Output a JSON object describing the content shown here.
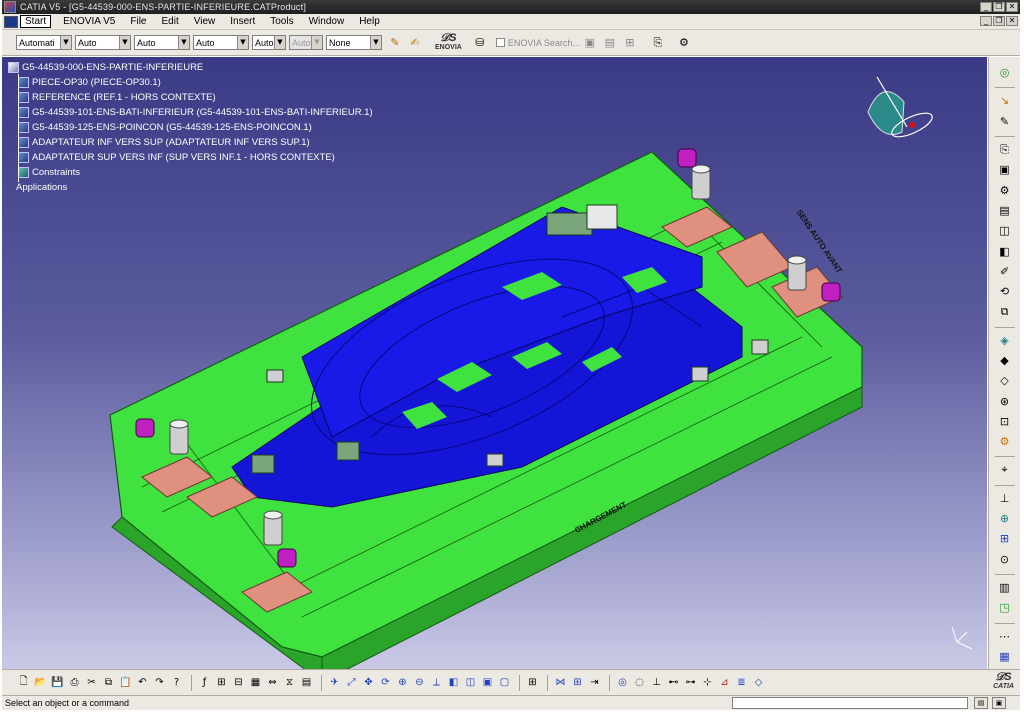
{
  "window": {
    "title": "CATIA V5 - [G5-44539-000-ENS-PARTIE-INFERIEURE.CATProduct]",
    "controls": {
      "minimize": "_",
      "restore": "❐",
      "close": "✕"
    }
  },
  "menu": {
    "items": [
      "Start",
      "ENOVIA V5",
      "File",
      "Edit",
      "View",
      "Insert",
      "Tools",
      "Window",
      "Help"
    ]
  },
  "toolbar_top": {
    "combos": [
      {
        "value": "Automati",
        "disabled": false
      },
      {
        "value": "Auto",
        "disabled": false
      },
      {
        "value": "Auto",
        "disabled": false
      },
      {
        "value": "Auto",
        "disabled": false
      },
      {
        "value": "Auto",
        "disabled": false
      },
      {
        "value": "Auto",
        "disabled": true
      },
      {
        "value": "None",
        "disabled": false
      }
    ],
    "enovia_logo": "ENOVIA",
    "enovia_search": "ENOVIA Search..."
  },
  "tree": {
    "root": "G5-44539-000-ENS-PARTIE-INFERIEURE",
    "children": [
      "PIECE-OP30 (PIECE-OP30.1)",
      "REFERENCE (REF.1 - HORS CONTEXTE)",
      "G5-44539-101-ENS-BATI-INFERIEUR (G5-44539-101-ENS-BATI-INFERIEUR.1)",
      "G5-44539-125-ENS-POINCON (G5-44539-125-ENS-POINCON.1)",
      "ADAPTATEUR INF VERS SUP (ADAPTATEUR INF VERS SUP.1)",
      "ADAPTATEUR SUP VERS INF (SUP VERS INF.1 - HORS CONTEXTE)",
      "Constraints"
    ],
    "applications": "Applications"
  },
  "viewport": {
    "annotation_a": "SENS AUTO AVANT",
    "annotation_b": "CHARGEMENT",
    "colors": {
      "background_top": "#3a3a86",
      "base": "#3fe23f",
      "base_dark": "#2aa52a",
      "die": "#1515d8",
      "pads": "#e0907f",
      "bolts": "#c020c0",
      "posts": "#cfcfcf"
    }
  },
  "toolbar_bottom": {
    "brand": "CATIA"
  },
  "status": {
    "text": "Select an object or a command"
  }
}
